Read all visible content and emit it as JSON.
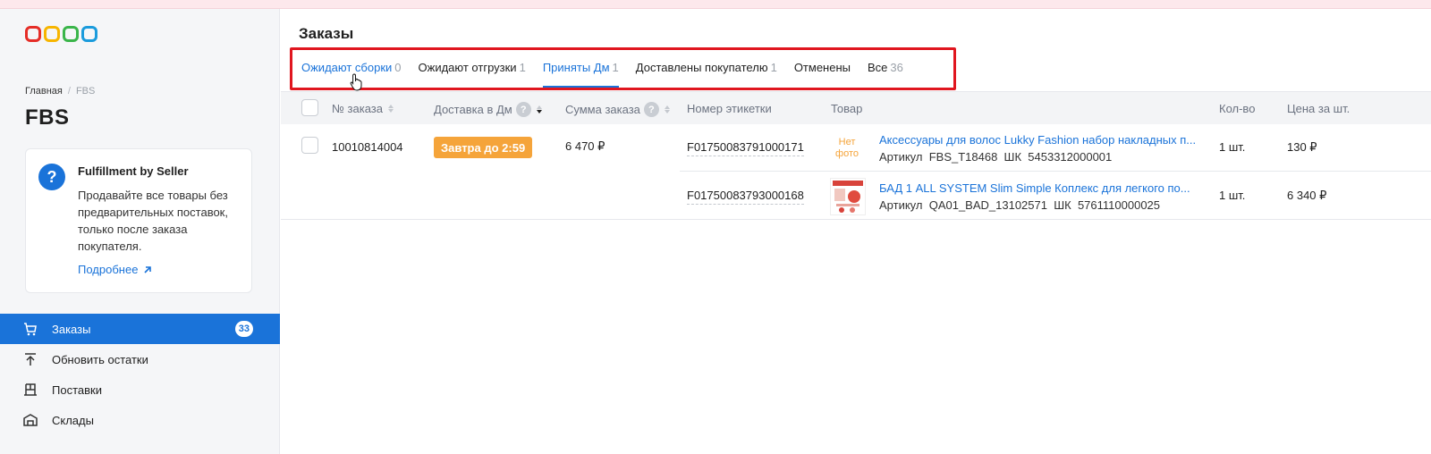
{
  "sidebar": {
    "logo_colors": [
      "#e52d27",
      "#f7b500",
      "#3ab54a",
      "#1a9bdc"
    ],
    "breadcrumb": {
      "home": "Главная",
      "separator": "/",
      "current": "FBS"
    },
    "title": "FBS",
    "info_card": {
      "title": "Fulfillment by Seller",
      "text": "Продавайте все товары без предварительных поставок, только после заказа покупателя.",
      "link": "Подробнее"
    },
    "nav": [
      {
        "label": "Заказы",
        "icon": "cart-icon",
        "badge": "33",
        "active": true
      },
      {
        "label": "Обновить остатки",
        "icon": "upload-icon"
      },
      {
        "label": "Поставки",
        "icon": "warehouse-rack-icon"
      },
      {
        "label": "Склады",
        "icon": "warehouse-icon"
      }
    ]
  },
  "main": {
    "title": "Заказы",
    "tabs": [
      {
        "label": "Ожидают сборки",
        "count": "0"
      },
      {
        "label": "Ожидают отгрузки",
        "count": "1"
      },
      {
        "label": "Приняты Дм",
        "count": "1",
        "active": true
      },
      {
        "label": "Доставлены покупателю",
        "count": "1"
      },
      {
        "label": "Отменены",
        "count": ""
      },
      {
        "label": "Все",
        "count": "36"
      }
    ],
    "columns": {
      "order_no": "№ заказа",
      "delivery": "Доставка в Дм",
      "sum": "Сумма заказа",
      "label": "Номер этикетки",
      "product": "Товар",
      "qty": "Кол-во",
      "price": "Цена за шт."
    },
    "order": {
      "number": "10010814004",
      "delivery_badge": "Завтра до 2:59",
      "sum": "6 470 ₽",
      "items": [
        {
          "label": "F01750083791000171",
          "no_photo": "Нет фото",
          "title": "Аксессуары для волос Lukky Fashion набор накладных п...",
          "article_label": "Артикул",
          "article": "FBS_T18468",
          "barcode_label": "ШК",
          "barcode": "5453312000001",
          "qty": "1 шт.",
          "price": "130 ₽"
        },
        {
          "label": "F01750083793000168",
          "title": "БАД 1 ALL SYSTEM Slim Simple Коплекс для легкого по...",
          "article_label": "Артикул",
          "article": "QA01_BAD_13102571",
          "barcode_label": "ШК",
          "barcode": "5761110000025",
          "qty": "1 шт.",
          "price": "6 340 ₽"
        }
      ]
    },
    "accent_color": "#1a73d9",
    "highlight_color": "#e0161f"
  }
}
